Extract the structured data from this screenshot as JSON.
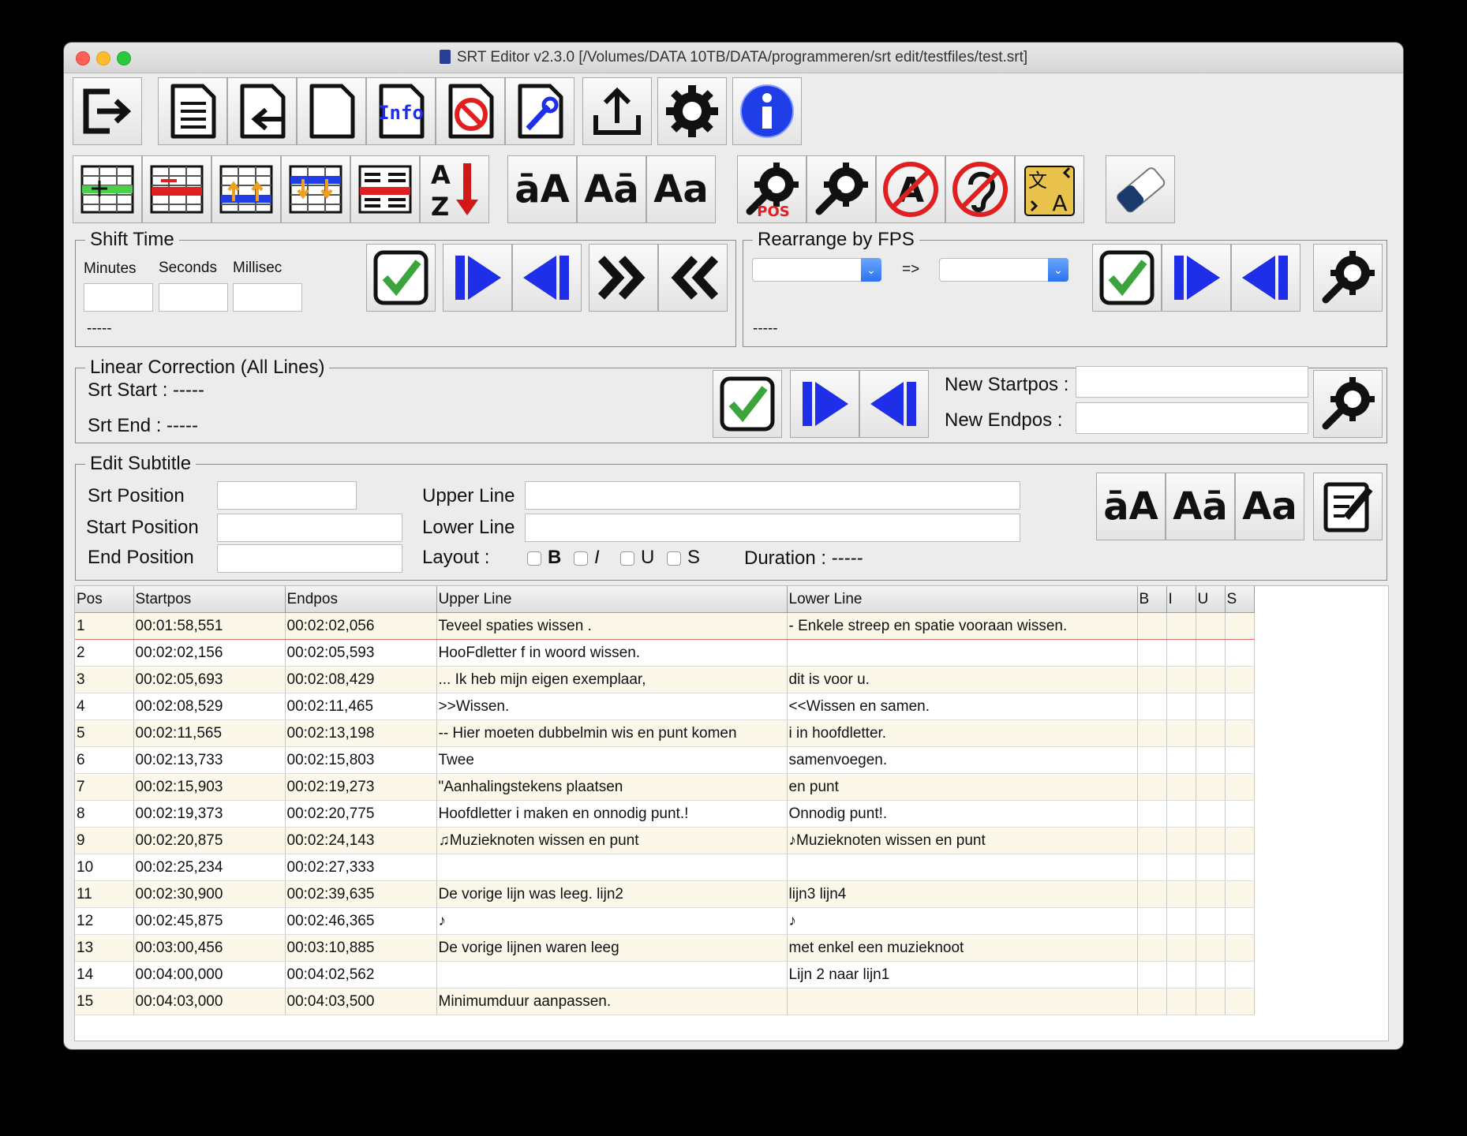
{
  "window": {
    "title": "SRT Editor v2.3.0 [/Volumes/DATA 10TB/DATA/programmeren/srt edit/testfiles/test.srt]"
  },
  "toolbar_top": [
    {
      "name": "exit-icon"
    },
    {
      "name": "document-icon"
    },
    {
      "name": "import-icon"
    },
    {
      "name": "new-file-icon"
    },
    {
      "name": "info-file-icon",
      "text": "Info"
    },
    {
      "name": "cancel-icon"
    },
    {
      "name": "edit-file-icon"
    },
    {
      "name": "export-icon"
    },
    {
      "name": "settings-icon"
    },
    {
      "name": "about-icon"
    }
  ],
  "toolbar_second": {
    "case_buttons": [
      "āA",
      "Aā",
      "Aa"
    ],
    "pos_label": "POS"
  },
  "shift_time": {
    "legend": "Shift Time",
    "minutes_label": "Minutes",
    "seconds_label": "Seconds",
    "millisec_label": "Millisec",
    "status": "-----"
  },
  "rearrange_fps": {
    "legend": "Rearrange by FPS",
    "arrow": "=>",
    "status": "-----"
  },
  "linear_correction": {
    "legend": "Linear Correction (All Lines)",
    "srt_start": "Srt Start : -----",
    "srt_end": "Srt End :  -----",
    "new_startpos_label": "New Startpos :",
    "new_endpos_label": "New Endpos :"
  },
  "edit_subtitle": {
    "legend": "Edit Subtitle",
    "srt_position_label": "Srt Position",
    "start_position_label": "Start Position",
    "end_position_label": "End Position",
    "upper_line_label": "Upper Line",
    "lower_line_label": "Lower Line",
    "layout_label": "Layout :",
    "bold": "B",
    "italic": "I",
    "underline": "U",
    "strike": "S",
    "duration": "Duration :  -----",
    "case_buttons": [
      "āA",
      "Aā",
      "Aa"
    ]
  },
  "table": {
    "headers": [
      "Pos",
      "Startpos",
      "Endpos",
      "Upper Line",
      "Lower Line",
      "B",
      "I",
      "U",
      "S"
    ],
    "rows": [
      [
        "1",
        "00:01:58,551",
        "00:02:02,056",
        "Teveel spaties   wissen     .",
        "- Enkele streep en spatie vooraan wissen.",
        "",
        "",
        "",
        ""
      ],
      [
        "2",
        "00:02:02,156",
        "00:02:05,593",
        "HooFdletter f in woord wissen.",
        "",
        "",
        "",
        "",
        ""
      ],
      [
        "3",
        "00:02:05,693",
        "00:02:08,429",
        "... Ik heb mijn eigen exemplaar,",
        "dit is voor u.",
        "",
        "",
        "",
        ""
      ],
      [
        "4",
        "00:02:08,529",
        "00:02:11,465",
        ">>Wissen.",
        "<<Wissen en samen.",
        "",
        "",
        "",
        ""
      ],
      [
        "5",
        "00:02:11,565",
        "00:02:13,198",
        "-- Hier moeten dubbelmin wis en punt komen",
        "i in hoofdletter.",
        "",
        "",
        "",
        ""
      ],
      [
        "6",
        "00:02:13,733",
        "00:02:15,803",
        "Twee",
        "samenvoegen.",
        "",
        "",
        "",
        ""
      ],
      [
        "7",
        "00:02:15,903",
        "00:02:19,273",
        "\"Aanhalingstekens plaatsen",
        "en punt",
        "",
        "",
        "",
        ""
      ],
      [
        "8",
        "00:02:19,373",
        "00:02:20,775",
        "Hoofdletter i maken en onnodig punt.!",
        "Onnodig punt!.",
        "",
        "",
        "",
        ""
      ],
      [
        "9",
        "00:02:20,875",
        "00:02:24,143",
        "♫Muzieknoten wissen en punt",
        "♪Muzieknoten wissen en punt",
        "",
        "",
        "",
        ""
      ],
      [
        "10",
        "00:02:25,234",
        "00:02:27,333",
        "",
        "",
        "",
        "",
        "",
        ""
      ],
      [
        "11",
        "00:02:30,900",
        "00:02:39,635",
        "De vorige lijn was leeg. lijn2",
        "lijn3 lijn4",
        "",
        "",
        "",
        ""
      ],
      [
        "12",
        "00:02:45,875",
        "00:02:46,365",
        "♪",
        "♪",
        "",
        "",
        "",
        ""
      ],
      [
        "13",
        "00:03:00,456",
        "00:03:10,885",
        "De vorige lijnen waren leeg",
        "met enkel een muzieknoot",
        "",
        "",
        "",
        ""
      ],
      [
        "14",
        "00:04:00,000",
        "00:04:02,562",
        "",
        "Lijn 2 naar lijn1",
        "",
        "",
        "",
        ""
      ],
      [
        "15",
        "00:04:03,000",
        "00:04:03,500",
        "Minimumduur aanpassen.",
        "",
        "",
        "",
        "",
        ""
      ]
    ]
  },
  "colors": {
    "accent_blue": "#1f2ee8",
    "check_green": "#3ca43c",
    "cancel_red": "#e02020",
    "row_alt": "#fbf8ea"
  }
}
